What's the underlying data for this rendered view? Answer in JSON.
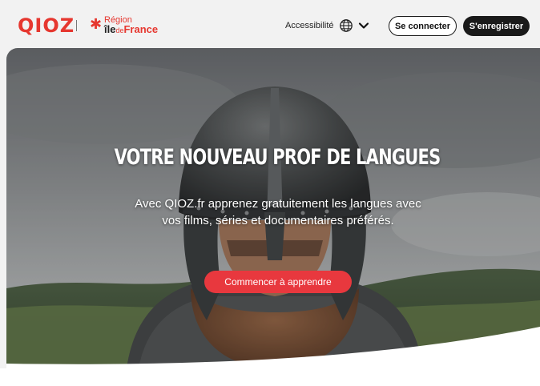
{
  "header": {
    "logo": "QIOZ",
    "region_top": "Région",
    "region_ile": "île",
    "region_de": "de",
    "region_france": "France",
    "accessibility": "Accessibilité",
    "login_label": "Se connecter",
    "register_label": "S'enregistrer"
  },
  "hero": {
    "title": "VOTRE NOUVEAU PROF DE LANGUES",
    "subtitle": "Avec QIOZ.fr apprenez gratuitement les langues avec vos films, séries et documentaires préférés.",
    "cta_label": "Commencer à apprendre"
  },
  "icons": {
    "language": "globe-icon",
    "dropdown": "chevron-down-icon"
  },
  "colors": {
    "brand_red": "#e6372f",
    "cta_red": "#e8383e",
    "dark": "#1a1a1a",
    "header_bg": "#f2f2f2"
  }
}
